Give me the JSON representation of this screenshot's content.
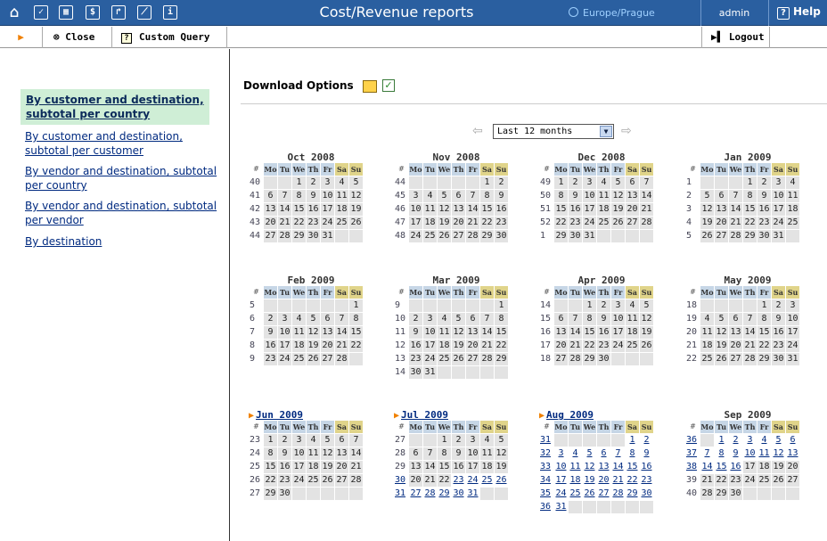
{
  "window": {
    "title": "Cost/Revenue reports",
    "timezone": "Europe/Prague",
    "user": "admin",
    "help": "Help"
  },
  "toolbar": {
    "close": "Close",
    "custom_query": "Custom Query",
    "logout": "Logout"
  },
  "sidebar": {
    "items": [
      "By customer and destination, subtotal per country",
      "By customer and destination, subtotal per customer",
      "By vendor and destination, subtotal per country",
      "By vendor and destination, subtotal per vendor",
      "By destination"
    ]
  },
  "download": {
    "label": "Download Options"
  },
  "period": {
    "selected": "Last 12 months"
  },
  "weekdays": [
    "Mo",
    "Tu",
    "We",
    "Th",
    "Fr",
    "Sa",
    "Su"
  ],
  "months": [
    {
      "title": "Oct 2008",
      "current": false,
      "weeks": [
        40,
        41,
        42,
        43,
        44
      ],
      "start": 2,
      "days": 31,
      "link_from": 0
    },
    {
      "title": "Nov 2008",
      "current": false,
      "weeks": [
        44,
        45,
        46,
        47,
        48
      ],
      "start": 5,
      "days": 30,
      "link_from": 0
    },
    {
      "title": "Dec 2008",
      "current": false,
      "weeks": [
        49,
        50,
        51,
        52,
        1
      ],
      "start": 0,
      "days": 31,
      "link_from": 0
    },
    {
      "title": "Jan 2009",
      "current": false,
      "weeks": [
        1,
        2,
        3,
        4,
        5
      ],
      "start": 3,
      "days": 31,
      "link_from": 0
    },
    {
      "title": "Feb 2009",
      "current": false,
      "weeks": [
        5,
        6,
        7,
        8,
        9
      ],
      "start": 6,
      "days": 28,
      "link_from": 0
    },
    {
      "title": "Mar 2009",
      "current": false,
      "weeks": [
        9,
        10,
        11,
        12,
        13,
        14
      ],
      "start": 6,
      "days": 31,
      "link_from": 0
    },
    {
      "title": "Apr 2009",
      "current": false,
      "weeks": [
        14,
        15,
        16,
        17,
        18
      ],
      "start": 2,
      "days": 30,
      "link_from": 0
    },
    {
      "title": "May 2009",
      "current": false,
      "weeks": [
        18,
        19,
        20,
        21,
        22
      ],
      "start": 4,
      "days": 31,
      "link_from": 0
    },
    {
      "title": "Jun 2009",
      "current": true,
      "weeks": [
        23,
        24,
        25,
        26,
        27
      ],
      "start": 0,
      "days": 30,
      "link_from": 0
    },
    {
      "title": "Jul 2009",
      "current": true,
      "weeks": [
        27,
        28,
        29,
        30,
        31
      ],
      "start": 2,
      "days": 31,
      "link_from": 23
    },
    {
      "title": "Aug 2009",
      "current": true,
      "weeks": [
        31,
        32,
        33,
        34,
        35,
        36
      ],
      "start": 5,
      "days": 31,
      "link_from": 1
    },
    {
      "title": "Sep 2009",
      "current": false,
      "weeks": [
        36,
        37,
        38,
        39,
        40
      ],
      "start": 1,
      "days": 30,
      "link_from": 1,
      "link_to": 16
    }
  ]
}
